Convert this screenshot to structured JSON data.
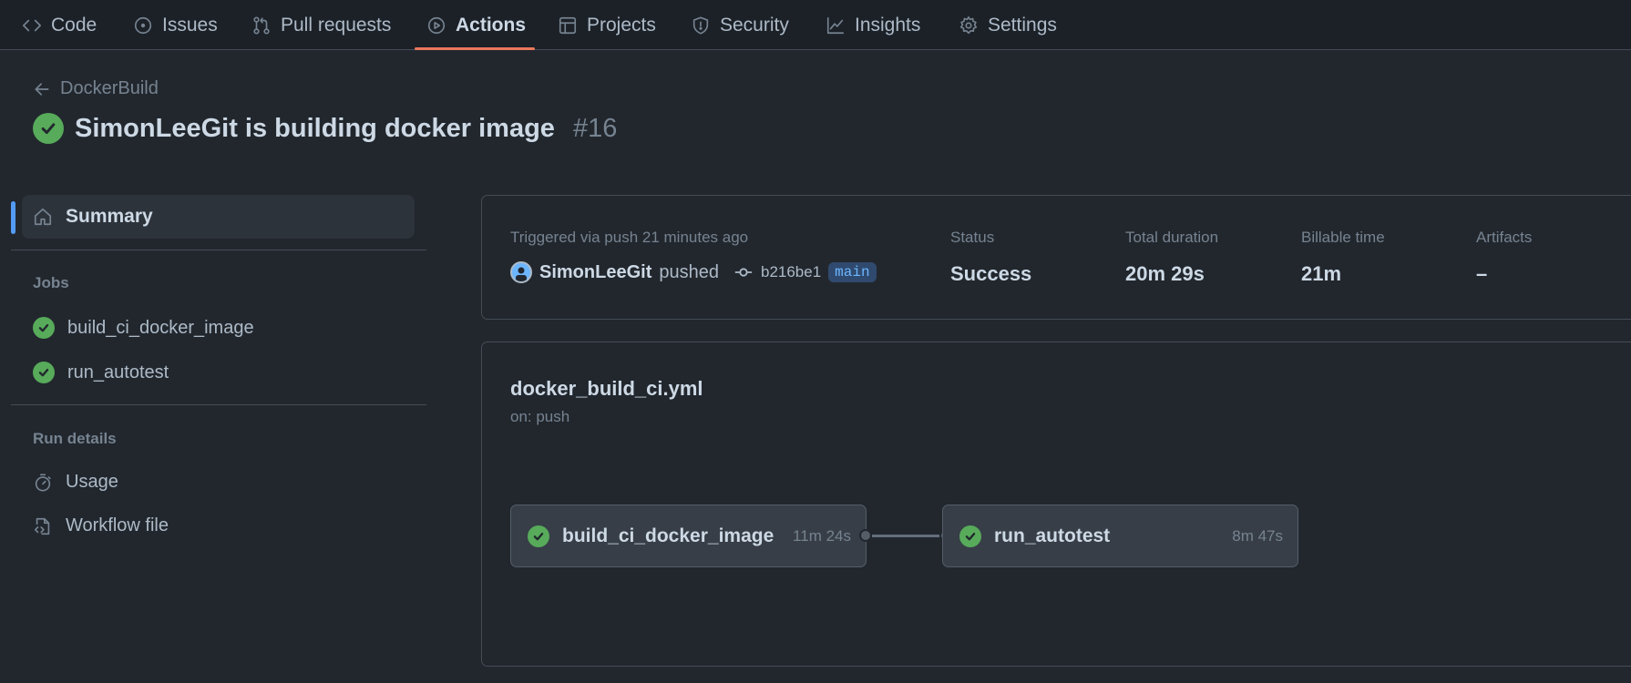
{
  "nav": {
    "tabs": [
      {
        "label": "Code",
        "icon": "code-icon"
      },
      {
        "label": "Issues",
        "icon": "issue-icon"
      },
      {
        "label": "Pull requests",
        "icon": "pull-request-icon"
      },
      {
        "label": "Actions",
        "icon": "play-icon",
        "active": true
      },
      {
        "label": "Projects",
        "icon": "table-icon"
      },
      {
        "label": "Security",
        "icon": "shield-icon"
      },
      {
        "label": "Insights",
        "icon": "graph-icon"
      },
      {
        "label": "Settings",
        "icon": "gear-icon"
      }
    ]
  },
  "header": {
    "back_label": "DockerBuild",
    "title": "SimonLeeGit is building docker image",
    "run_number": "#16"
  },
  "sidebar": {
    "summary_label": "Summary",
    "jobs_heading": "Jobs",
    "jobs": [
      "build_ci_docker_image",
      "run_autotest"
    ],
    "run_details_heading": "Run details",
    "usage_label": "Usage",
    "workflow_file_label": "Workflow file"
  },
  "summary": {
    "trigger_text": "Triggered via push 21 minutes ago",
    "actor": "SimonLeeGit",
    "action": "pushed",
    "commit": "b216be1",
    "branch": "main",
    "status_label": "Status",
    "status_value": "Success",
    "duration_label": "Total duration",
    "duration_value": "20m 29s",
    "billable_label": "Billable time",
    "billable_value": "21m",
    "artifacts_label": "Artifacts",
    "artifacts_value": "–"
  },
  "workflow": {
    "file": "docker_build_ci.yml",
    "trigger": "on: push",
    "jobs": [
      {
        "name": "build_ci_docker_image",
        "duration": "11m 24s"
      },
      {
        "name": "run_autotest",
        "duration": "8m 47s"
      }
    ]
  },
  "colors": {
    "success": "#57ab5a",
    "accent_underline": "#ec775c",
    "summary_bar": "#539bf5"
  }
}
